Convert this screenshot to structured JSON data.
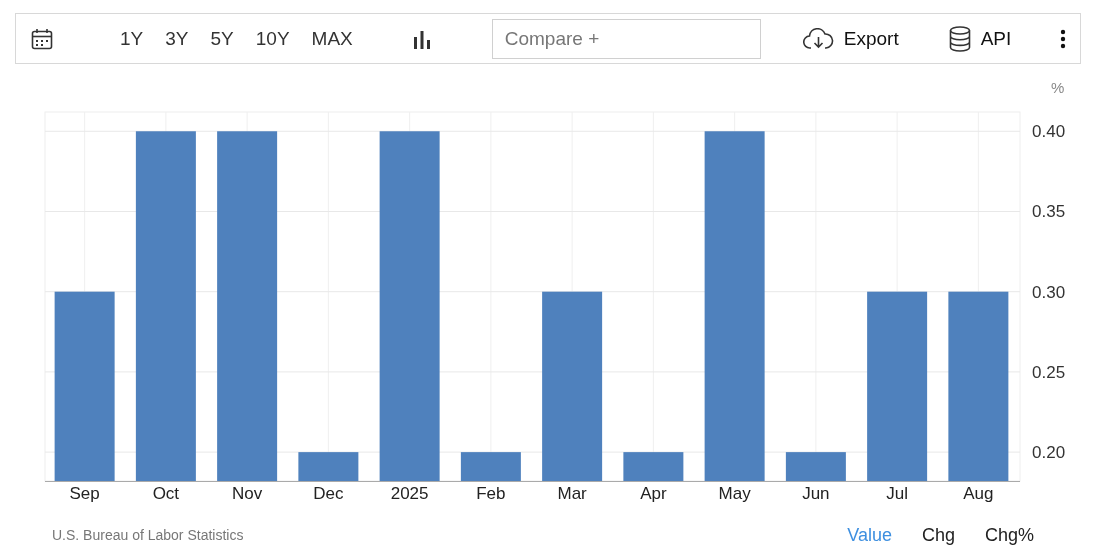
{
  "toolbar": {
    "ranges": [
      "1Y",
      "3Y",
      "5Y",
      "10Y",
      "MAX"
    ],
    "compare": {
      "placeholder": "Compare +"
    },
    "actions": [
      {
        "kind": "export",
        "label": "Export"
      },
      {
        "kind": "api",
        "label": "API"
      }
    ]
  },
  "chart": {
    "chart_data": {
      "type": "bar",
      "ylabel": "%",
      "categories": [
        "Sep",
        "Oct",
        "Nov",
        "Dec",
        "2025",
        "Feb",
        "Mar",
        "Apr",
        "May",
        "Jun",
        "Jul",
        "Aug"
      ],
      "grid": true,
      "series": [
        {
          "color": "#4f81bd",
          "values": [
            0.3,
            0.4,
            0.4,
            0.2,
            0.4,
            0.2,
            0.3,
            0.2,
            0.4,
            0.2,
            0.3,
            0.3
          ]
        }
      ],
      "ylim": [
        0.182,
        0.412
      ],
      "yticks": [
        {
          "value": 0.2,
          "label": "0.20"
        },
        {
          "value": 0.25,
          "label": "0.25"
        },
        {
          "value": 0.3,
          "label": "0.30"
        },
        {
          "value": 0.35,
          "label": "0.35"
        },
        {
          "value": 0.4,
          "label": "0.40"
        }
      ]
    }
  },
  "footer": {
    "source": "U.S. Bureau of Labor Statistics",
    "views": [
      {
        "label": "Value",
        "selected": true
      },
      {
        "label": "Chg",
        "selected": false
      },
      {
        "label": "Chg%",
        "selected": false
      }
    ]
  }
}
